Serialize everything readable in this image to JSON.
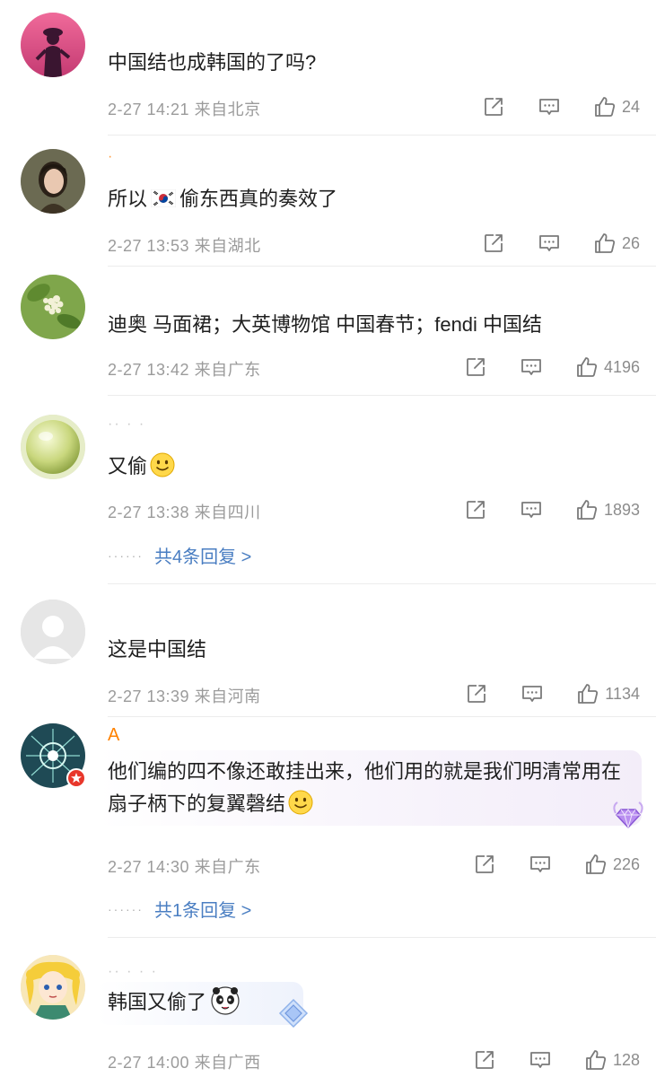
{
  "comments": [
    {
      "name": "",
      "text": "中国结也成韩国的了吗?",
      "time": "2-27 14:21",
      "location": "来自北京",
      "likes": "24",
      "avatar": "silhouette-pink",
      "replies": ""
    },
    {
      "name": "",
      "text_pre": "所以",
      "flag": "south-korea-flag",
      "text_post": "偷东西真的奏效了",
      "time": "2-27 13:53",
      "location": "来自湖北",
      "likes": "26",
      "avatar": "woman-portrait"
    },
    {
      "name": "",
      "text": "迪奥 马面裙；大英博物馆 中国春节；fendi 中国结",
      "time": "2-27 13:42",
      "location": "来自广东",
      "likes": "4196",
      "avatar": "flowers"
    },
    {
      "name": "",
      "text": "又偷",
      "emoji": "smile-emoji",
      "time": "2-27 13:38",
      "location": "来自四川",
      "likes": "1893",
      "avatar": "green-sphere",
      "replies": "共4条回复 >"
    },
    {
      "name": "",
      "text": "这是中国结",
      "time": "2-27 13:39",
      "location": "来自河南",
      "likes": "1134",
      "avatar": "default-user"
    },
    {
      "name": "A",
      "text": "他们编的四不像还敢挂出来，他们用的就是我们明清常用在扇子柄下的复翼磬结",
      "emoji": "smile-emoji",
      "time": "2-27 14:30",
      "location": "来自广东",
      "likes": "226",
      "avatar": "fireworks",
      "replies": "共1条回复 >"
    },
    {
      "name": "",
      "text": "韩国又偷了",
      "emoji": "panda-emoji",
      "time": "2-27 14:00",
      "location": "来自广西",
      "likes": "128",
      "avatar": "anime-girl"
    }
  ],
  "colors": {
    "reply_link": "#4a7ec2",
    "meta": "#9b9b9b",
    "name": "#ff8200",
    "divider": "#ececec"
  },
  "icons": [
    "share-icon",
    "comment-icon",
    "like-icon"
  ]
}
